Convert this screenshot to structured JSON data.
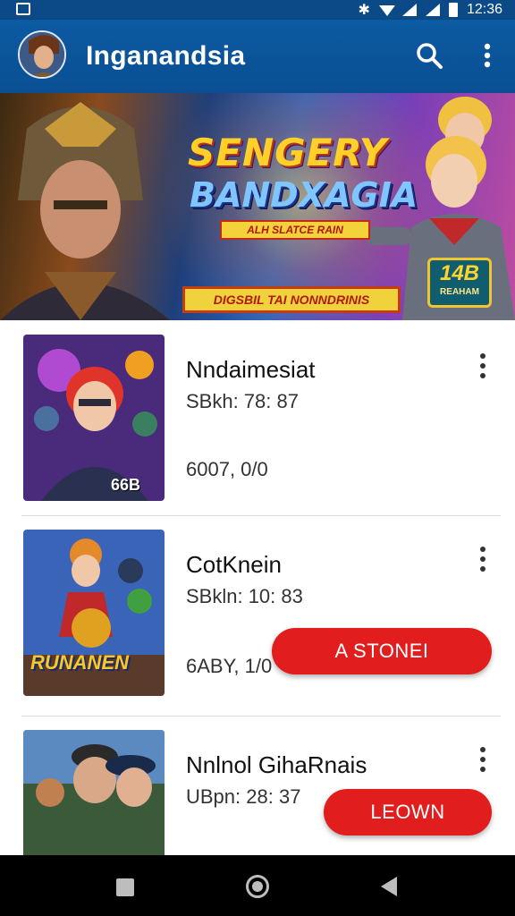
{
  "status_bar": {
    "time": "12:36"
  },
  "app_bar": {
    "title": "Inganandsia"
  },
  "banner": {
    "title_line1": "SENGERY",
    "title_line2": "BANDXAGIA",
    "ribbon": "ALH SLATCE RAIN",
    "bottom_strip": "DIGSBIL TAI NONNDRINIS",
    "badge_number": "14B",
    "badge_sub": "REAHAM"
  },
  "games": [
    {
      "title": "Nndaimesiat",
      "subtitle": "SBkh: 78: 87",
      "size": "6007, 0/0",
      "action": "",
      "thumb_badge": "66B"
    },
    {
      "title": "CotKnein",
      "subtitle": "SBkln: 10: 83",
      "size": "6ABY, 1/0",
      "action": "A STONEI",
      "thumb_badge": "RUNANEN"
    },
    {
      "title": "Nnlnol GihaRnais",
      "subtitle": "UBpn: 28: 37",
      "size": "",
      "action": "LEOWN",
      "thumb_badge": ""
    }
  ],
  "colors": {
    "app_bar": "#0c5aa3",
    "status_bar": "#0b4a86",
    "action_button": "#e11d1d",
    "nav_bar": "#000000"
  },
  "icons": {
    "search": "search-icon",
    "more": "more-vert-icon",
    "recents": "square-icon",
    "home": "circle-icon",
    "back": "triangle-back-icon"
  }
}
